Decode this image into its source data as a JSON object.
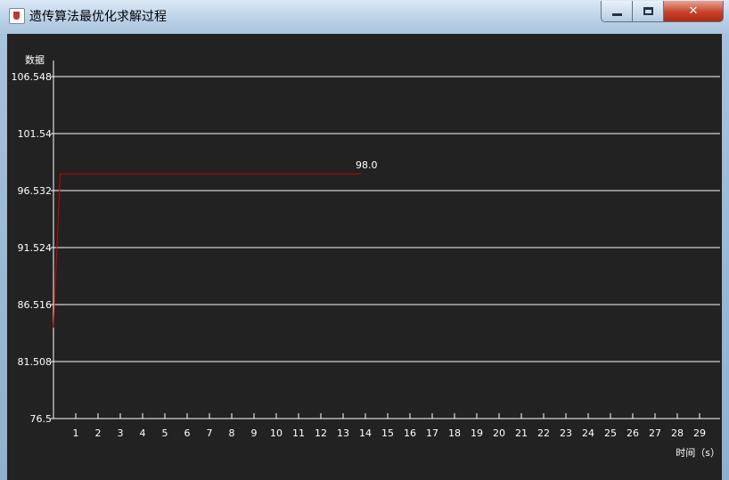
{
  "window": {
    "title": "遗传算法最优化求解过程",
    "minimize_label": "",
    "maximize_label": "",
    "close_label": "✕"
  },
  "chart_data": {
    "type": "line",
    "title": "",
    "xlabel": "时间（s）",
    "ylabel": "数据",
    "xlim": [
      0,
      29.8
    ],
    "ylim": [
      76.5,
      107.5
    ],
    "x_ticks": [
      1,
      2,
      3,
      4,
      5,
      6,
      7,
      8,
      9,
      10,
      11,
      12,
      13,
      14,
      15,
      16,
      17,
      18,
      19,
      20,
      21,
      22,
      23,
      24,
      25,
      26,
      27,
      28,
      29
    ],
    "y_ticks": [
      {
        "value": 76.5,
        "label": "76.5"
      },
      {
        "value": 81.508,
        "label": "81.508"
      },
      {
        "value": 86.516,
        "label": "86.516"
      },
      {
        "value": 91.524,
        "label": "91.524"
      },
      {
        "value": 96.532,
        "label": "96.532"
      },
      {
        "value": 101.54,
        "label": "101.54"
      },
      {
        "value": 106.548,
        "label": "106.548"
      }
    ],
    "grid": true,
    "series": [
      {
        "color": "#d40000",
        "x": [
          0,
          0.3,
          13.8
        ],
        "y": [
          84.5,
          98.0,
          98.0
        ]
      }
    ],
    "annotations": [
      {
        "text": "98.0",
        "x": 13.8,
        "y": 98.0,
        "color": "#d40000"
      }
    ]
  }
}
